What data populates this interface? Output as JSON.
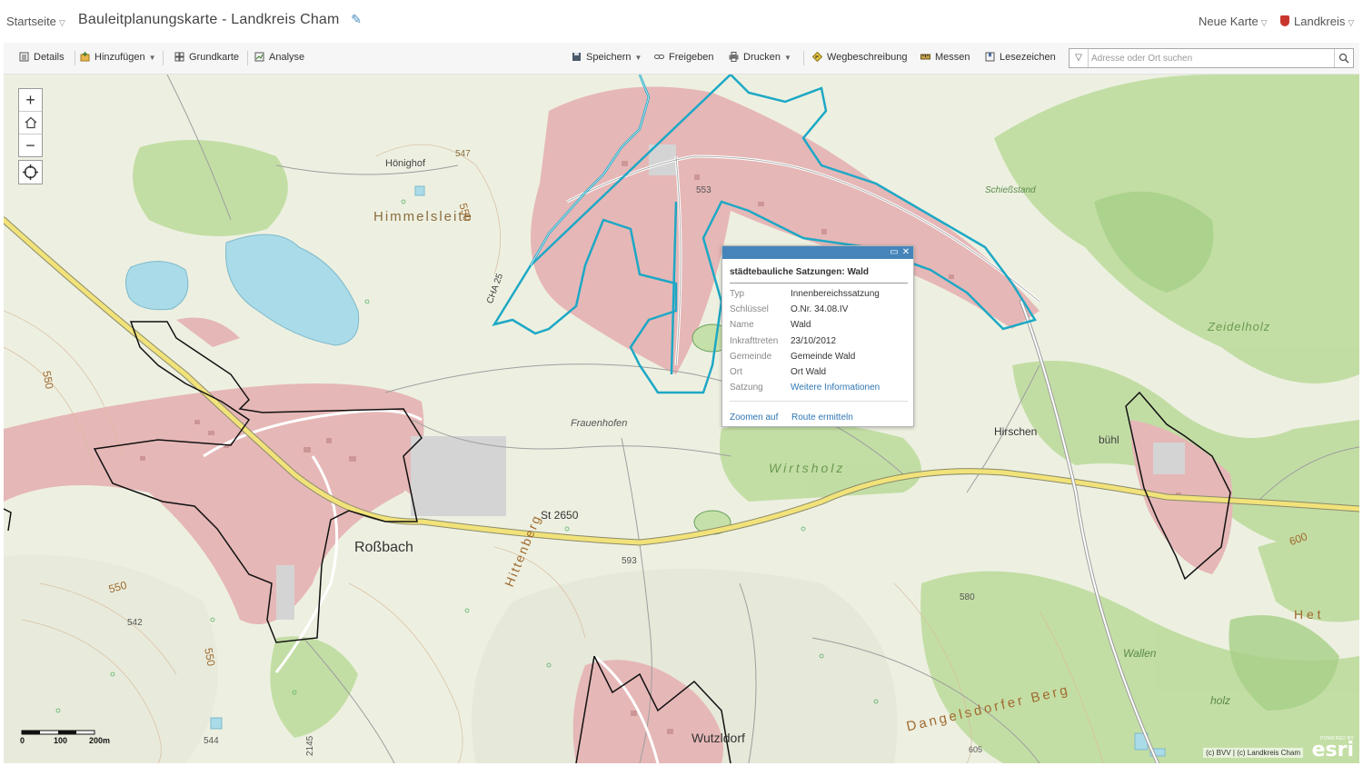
{
  "header": {
    "home_label": "Startseite",
    "title": "Bauleitplanungskarte - Landkreis Cham",
    "new_map_label": "Neue Karte",
    "account_label": "Landkreis"
  },
  "toolbar": {
    "details": "Details",
    "add": "Hinzufügen",
    "basemap": "Grundkarte",
    "analysis": "Analyse",
    "save": "Speichern",
    "share": "Freigeben",
    "print": "Drucken",
    "directions": "Wegbeschreibung",
    "measure": "Messen",
    "bookmarks": "Lesezeichen",
    "search_placeholder": "Adresse oder Ort suchen"
  },
  "map_labels": {
    "himmelsleite": "Himmelsleite",
    "honighof": "Hönighof",
    "rossbach": "Roßbach",
    "frauenhofen": "Frauenhofen",
    "wirtsholz": "Wirtsholz",
    "hirschen": "Hirschen",
    "buhl": "bühl",
    "schiessstand": "Schießstand",
    "zeidelholz": "Zeidelholz",
    "hittenberg": "Hittenberg",
    "wutzldorf": "Wutzldorf",
    "dangelsdorfer_berg": "Dangelsdorfer Berg",
    "holz": "holz",
    "wallen": "Wallen",
    "het": "H e t",
    "st2650": "St 2650",
    "cha25": "CHA 25",
    "e547": "547",
    "e550a": "550",
    "e550b": "550",
    "e550c": "550",
    "e550d": "550",
    "e553": "553",
    "e542": "542",
    "e544": "544",
    "e580": "580",
    "e593": "593",
    "e600": "600",
    "e2145": "2145",
    "e605": "605"
  },
  "popup": {
    "title": "städtebauliche Satzungen: Wald",
    "fields": [
      {
        "key": "Typ",
        "value": "Innenbereichssatzung"
      },
      {
        "key": "Schlüssel",
        "value": "O.Nr. 34.08.IV"
      },
      {
        "key": "Name",
        "value": "Wald"
      },
      {
        "key": "Inkrafttreten",
        "value": "23/10/2012"
      },
      {
        "key": "Gemeinde",
        "value": "Gemeinde Wald"
      },
      {
        "key": "Ort",
        "value": "Ort Wald"
      },
      {
        "key": "Satzung",
        "value": "Weitere Informationen"
      }
    ],
    "zoom_link": "Zoomen auf",
    "route_link": "Route ermitteln"
  },
  "scale": {
    "label_100": "100",
    "label_200": "200m",
    "label_0": "0"
  },
  "attribution": "(c) BVV | (c) Landkreis Cham",
  "esri": {
    "powered": "POWERED BY",
    "logo": "esri"
  },
  "colors": {
    "popup_header": "#4585bb",
    "highlight_outline": "#2bb3cc",
    "settlement": "#e8b8b8",
    "forest": "#b9d89a",
    "water": "#a8dbe8",
    "main_road": "#f0e27a"
  }
}
